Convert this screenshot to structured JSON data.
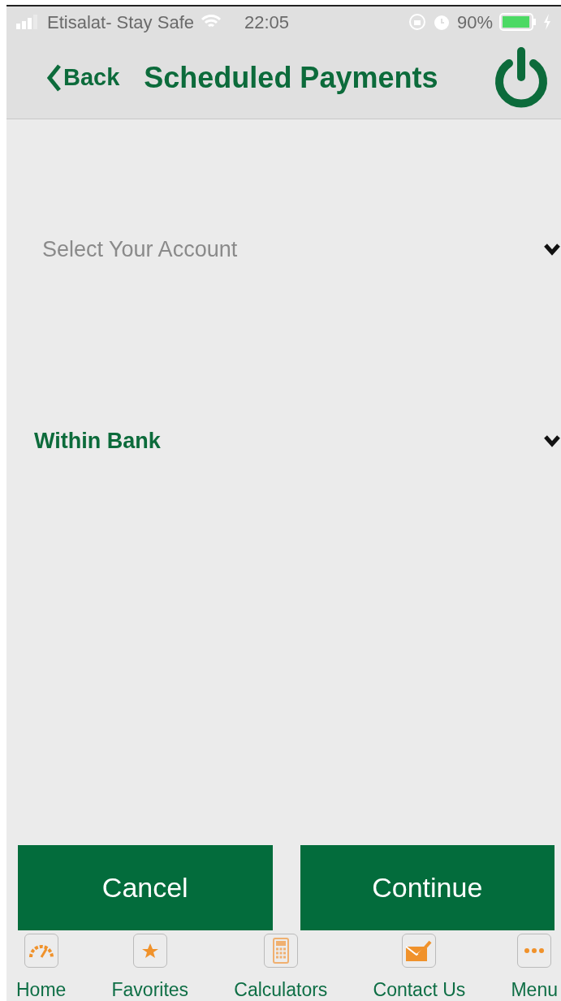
{
  "status_bar": {
    "carrier": "Etisalat- Stay Safe",
    "time": "22:05",
    "battery": "90%"
  },
  "header": {
    "back": "Back",
    "title": "Scheduled Payments"
  },
  "fields": [
    {
      "kind": "placeholder",
      "text": "Select Your Account"
    },
    {
      "kind": "value",
      "text": "Within Bank"
    }
  ],
  "buttons": [
    "Cancel",
    "Continue"
  ],
  "tab_bar": [
    {
      "label": "Home"
    },
    {
      "label": "Favorites"
    },
    {
      "label": "Calculators"
    },
    {
      "label": "Contact Us"
    },
    {
      "label": "Menu"
    }
  ]
}
